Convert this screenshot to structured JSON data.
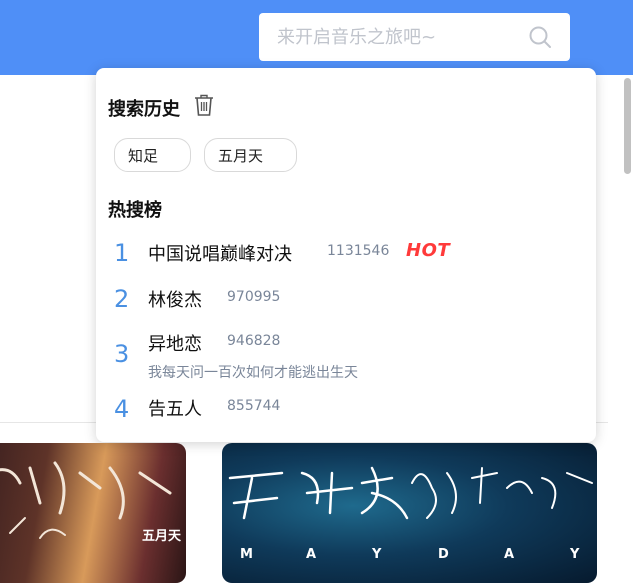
{
  "search": {
    "placeholder": "来开启音乐之旅吧~"
  },
  "dropdown": {
    "history_title": "搜索历史",
    "history_tags": [
      {
        "label": "知足"
      },
      {
        "label": "五月天"
      }
    ],
    "hot_title": "热搜榜",
    "hot_list": [
      {
        "rank": "1",
        "song": "中国说唱巅峰对决",
        "count": "1131546",
        "badge": "HOT",
        "subtitle": ""
      },
      {
        "rank": "2",
        "song": "林俊杰",
        "count": "970995",
        "badge": "",
        "subtitle": ""
      },
      {
        "rank": "3",
        "song": "异地恋",
        "count": "946828",
        "badge": "",
        "subtitle": "我每天问一百次如何才能逃出生天"
      },
      {
        "rank": "4",
        "song": "告五人",
        "count": "855744",
        "badge": "",
        "subtitle": ""
      }
    ]
  },
  "albums": {
    "left_label": "五月天",
    "right_letters": [
      "M",
      "A",
      "Y",
      "D",
      "A",
      "Y"
    ]
  },
  "colors": {
    "topbar": "#4f8ff7",
    "rank": "#4a90e2",
    "hot_badge": "#ff3a3a"
  },
  "icons": [
    "search-icon",
    "trash-icon"
  ]
}
